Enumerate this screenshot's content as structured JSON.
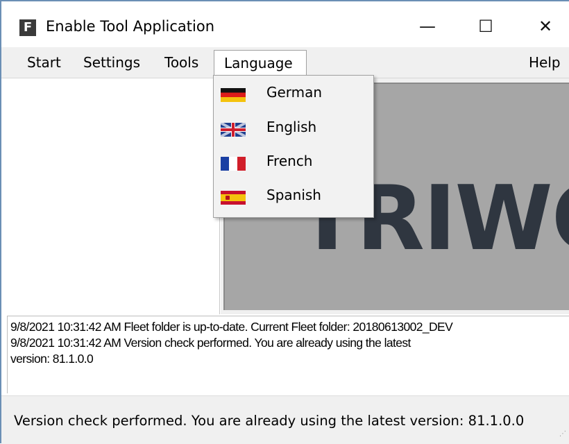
{
  "window": {
    "icon_letter": "F",
    "title": "Enable Tool Application",
    "minimize_glyph": "—",
    "maximize_glyph": "☐",
    "close_glyph": "✕"
  },
  "menu": {
    "start": "Start",
    "settings": "Settings",
    "tools": "Tools",
    "language": "Language",
    "help": "Help"
  },
  "language_menu": {
    "items": [
      {
        "label": "German",
        "flag": "germany-flag-icon"
      },
      {
        "label": "English",
        "flag": "uk-flag-icon"
      },
      {
        "label": "French",
        "flag": "france-flag-icon"
      },
      {
        "label": "Spanish",
        "flag": "spain-flag-icon"
      }
    ]
  },
  "logo": {
    "text": "TRIWO"
  },
  "log": {
    "lines": [
      "9/8/2021 10:31:42 AM Fleet folder is up-to-date. Current Fleet folder: 20180613002_DEV",
      "9/8/2021 10:31:42 AM Version check performed. You are already using the latest",
      "version: 81.1.0.0"
    ]
  },
  "status": {
    "text": "Version check performed. You are already using the latest version: 81.1.0.0"
  }
}
